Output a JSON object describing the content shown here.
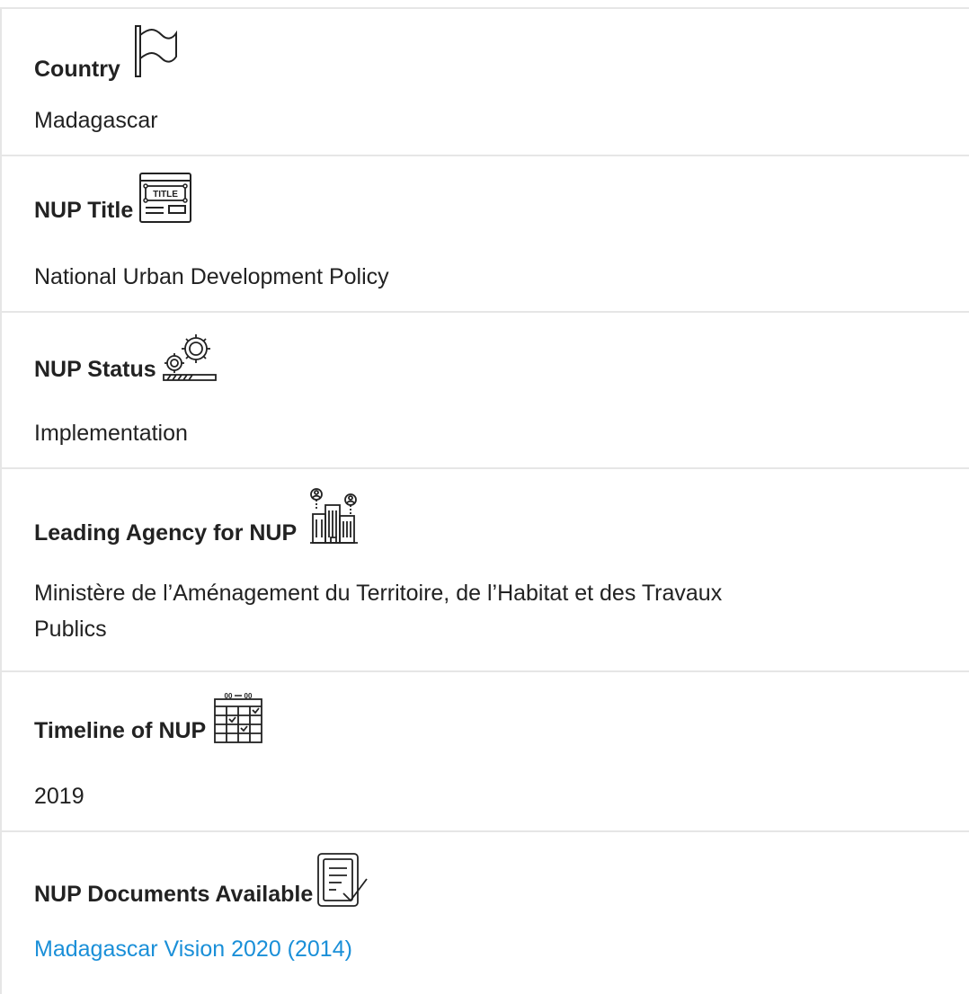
{
  "rows": [
    {
      "label": "Country",
      "icon": "flag-icon",
      "value": "Madagascar"
    },
    {
      "label": "NUP Title",
      "icon": "title-window-icon",
      "value": "National Urban Development Policy",
      "icon_text": "TITLE"
    },
    {
      "label": "NUP Status",
      "icon": "gears-progress-icon",
      "value": "Implementation"
    },
    {
      "label": "Leading Agency for NUP",
      "icon": "city-agency-icon",
      "value_line1": "Ministère de l’Aménagement du Territoire, de l’Habitat et des Travaux",
      "value_line2": "Publics"
    },
    {
      "label": "Timeline of NUP",
      "icon": "calendar-icon",
      "value": "2019",
      "icon_text_left": "00",
      "icon_text_right": "00"
    },
    {
      "label": "NUP Documents Available",
      "icon": "document-check-icon",
      "link": "Madagascar Vision 2020 (2014)"
    }
  ],
  "colors": {
    "text": "#222222",
    "link": "#1a8fd8",
    "divider": "#e6e6e6"
  }
}
